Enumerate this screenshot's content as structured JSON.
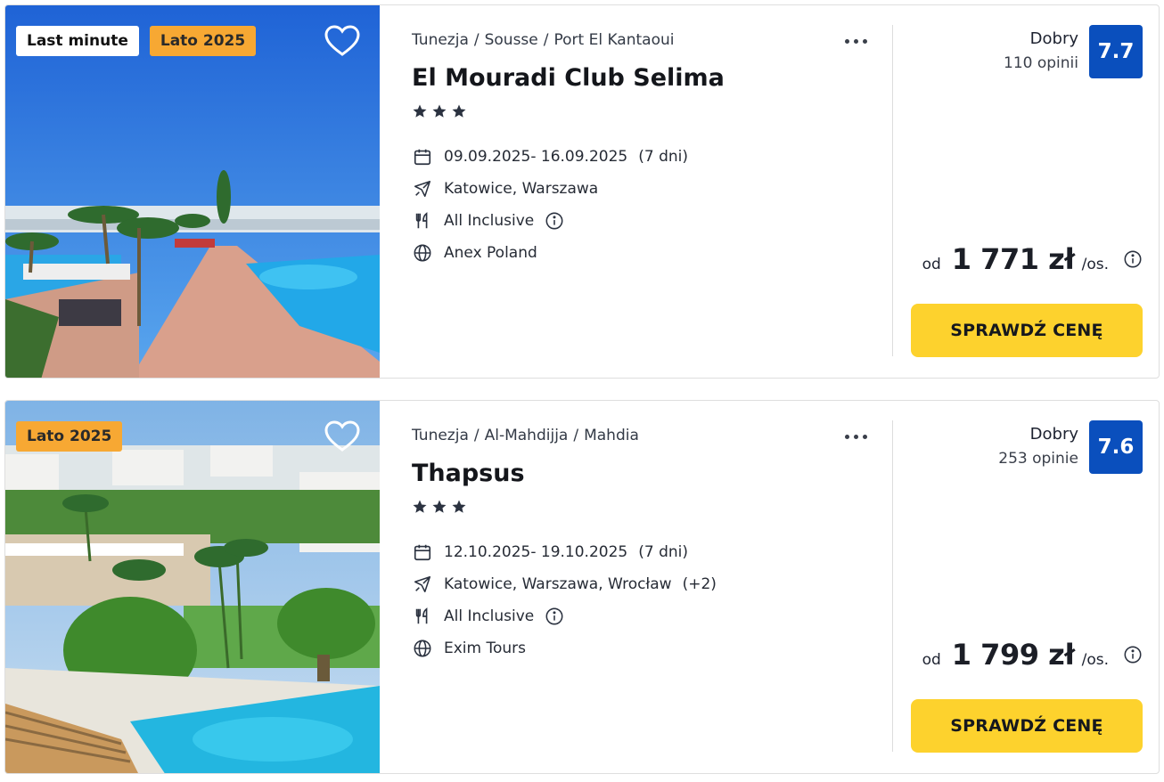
{
  "offers": [
    {
      "badges": [
        "Last minute",
        "Lato 2025"
      ],
      "breadcrumb": [
        "Tunezja",
        "Sousse",
        "Port El Kantaoui"
      ],
      "name": "El Mouradi Club Selima",
      "stars": 3,
      "dates": "09.09.2025- 16.09.2025",
      "duration": "(7 dni)",
      "departures": "Katowice, Warszawa",
      "departures_extra": "",
      "board": "All Inclusive",
      "operator": "Anex Poland",
      "rating_word": "Dobry",
      "rating_count": "110 opinii",
      "score": "7.7",
      "price_prefix": "od",
      "price": "1 771 zł",
      "price_unit": "/os.",
      "cta": "SPRAWDŹ CENĘ"
    },
    {
      "badges": [
        "Lato 2025"
      ],
      "breadcrumb": [
        "Tunezja",
        "Al-Mahdijja",
        "Mahdia"
      ],
      "name": "Thapsus",
      "stars": 3,
      "dates": "12.10.2025- 19.10.2025",
      "duration": "(7 dni)",
      "departures": "Katowice, Warszawa, Wrocław",
      "departures_extra": "(+2)",
      "board": "All Inclusive",
      "operator": "Exim Tours",
      "rating_word": "Dobry",
      "rating_count": "253 opinie",
      "score": "7.6",
      "price_prefix": "od",
      "price": "1 799 zł",
      "price_unit": "/os.",
      "cta": "SPRAWDŹ CENĘ"
    }
  ],
  "colors": {
    "score_bg": "#0a4fbd",
    "cta_bg": "#fdd22d",
    "badge_orange": "#f7a833"
  },
  "icons": [
    "heart-icon",
    "more-dots-icon",
    "star-icon",
    "calendar-icon",
    "plane-icon",
    "utensils-icon",
    "info-icon",
    "globe-icon"
  ]
}
